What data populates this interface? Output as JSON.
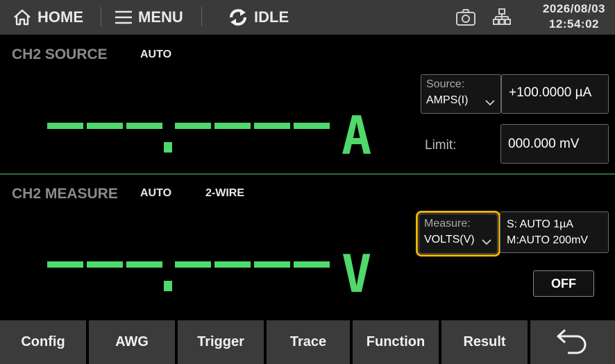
{
  "topbar": {
    "home_label": "HOME",
    "menu_label": "MENU",
    "status_label": "IDLE",
    "date": "2026/08/03",
    "time": "12:54:02"
  },
  "source": {
    "title": "CH2 SOURCE",
    "range_mode": "AUTO",
    "readout_unit": "A",
    "function_label": "Source:",
    "function_value": "AMPS(I)",
    "level_value": "+100.0000 µA",
    "limit_label": "Limit:",
    "limit_value": "000.000 mV"
  },
  "measure": {
    "title": "CH2 MEASURE",
    "range_mode": "AUTO",
    "wiring": "2-WIRE",
    "readout_unit": "V",
    "function_label": "Measure:",
    "function_value": "VOLTS(V)",
    "source_range": "S:  AUTO 1µA",
    "measure_range": "M:AUTO 200mV",
    "output_label": "OFF"
  },
  "softkeys": [
    "Config",
    "AWG",
    "Trigger",
    "Trace",
    "Function",
    "Result"
  ],
  "colors": {
    "readout_green": "#4fd86b",
    "highlight": "#f2b300",
    "topbar": "#3a3a3a",
    "softkey": "#3b3b3b"
  }
}
